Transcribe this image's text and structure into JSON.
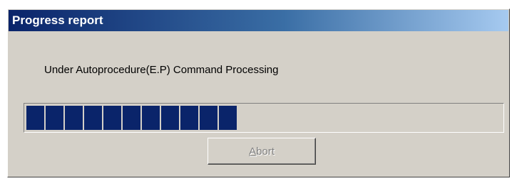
{
  "window": {
    "title": "Progress report"
  },
  "message": "Under Autoprocedure(E.P) Command Processing",
  "progress": {
    "filled_blocks": 11,
    "total_blocks": 25,
    "fraction": 0.44,
    "bar_color": "#0a246a"
  },
  "abort_button": {
    "label": "Abort",
    "mnemonic": "A",
    "rest": "bort",
    "enabled": false
  },
  "colors": {
    "face": "#d4d0c8",
    "title_start": "#0a246a",
    "title_end": "#a6caf0",
    "disabled_text": "#808080"
  }
}
